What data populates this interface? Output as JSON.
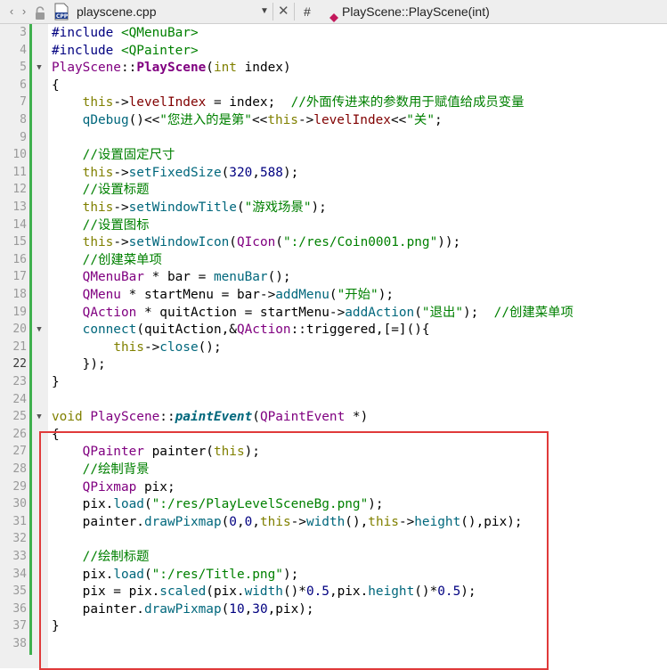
{
  "tabbar": {
    "back_glyph": "‹",
    "forward_glyph": "›",
    "lock_icon": "lock-icon",
    "file_icon": "cpp-file-icon",
    "filename": "playscene.cpp",
    "dropdown_glyph": "▼",
    "close_glyph": "✕",
    "symbol_hash": "#",
    "function_icon": "function-icon",
    "current_function": "PlayScene::PlayScene(int)"
  },
  "colors": {
    "highlight_box": "#e03a3a",
    "modified_bar": "#3fb04e",
    "function_icon": "#c2185b"
  },
  "lines": [
    {
      "num": "3",
      "fold": "",
      "cur": false,
      "tokens": [
        [
          "pp",
          "#include "
        ],
        [
          "inc",
          "<QMenuBar>"
        ]
      ]
    },
    {
      "num": "4",
      "fold": "",
      "cur": false,
      "tokens": [
        [
          "pp",
          "#include "
        ],
        [
          "inc",
          "<QPainter>"
        ]
      ]
    },
    {
      "num": "5",
      "fold": "▼",
      "cur": false,
      "tokens": [
        [
          "cls",
          "PlayScene"
        ],
        [
          "",
          "::"
        ],
        [
          "cls bold",
          "PlayScene"
        ],
        [
          "",
          "("
        ],
        [
          "kw",
          "int"
        ],
        [
          "",
          " index)"
        ]
      ]
    },
    {
      "num": "6",
      "fold": "",
      "cur": false,
      "tokens": [
        [
          "",
          "{"
        ]
      ]
    },
    {
      "num": "7",
      "fold": "",
      "cur": false,
      "tokens": [
        [
          "",
          "    "
        ],
        [
          "kw",
          "this"
        ],
        [
          "",
          "->"
        ],
        [
          "mem",
          "levelIndex"
        ],
        [
          "",
          " = index;  "
        ],
        [
          "cmt",
          "//外面传进来的参数用于赋值给成员变量"
        ]
      ]
    },
    {
      "num": "8",
      "fold": "",
      "cur": false,
      "tokens": [
        [
          "",
          "    "
        ],
        [
          "fn",
          "qDebug"
        ],
        [
          "",
          "()<<"
        ],
        [
          "str",
          "\"您进入的是第\""
        ],
        [
          "",
          "<<"
        ],
        [
          "kw",
          "this"
        ],
        [
          "",
          "->"
        ],
        [
          "mem",
          "levelIndex"
        ],
        [
          "",
          "<<"
        ],
        [
          "str",
          "\"关\""
        ],
        [
          "",
          ";"
        ]
      ]
    },
    {
      "num": "9",
      "fold": "",
      "cur": false,
      "tokens": []
    },
    {
      "num": "10",
      "fold": "",
      "cur": false,
      "tokens": [
        [
          "",
          "    "
        ],
        [
          "cmt",
          "//设置固定尺寸"
        ]
      ]
    },
    {
      "num": "11",
      "fold": "",
      "cur": false,
      "tokens": [
        [
          "",
          "    "
        ],
        [
          "kw",
          "this"
        ],
        [
          "",
          "->"
        ],
        [
          "fn",
          "setFixedSize"
        ],
        [
          "",
          "("
        ],
        [
          "num",
          "320"
        ],
        [
          "",
          ","
        ],
        [
          "num",
          "588"
        ],
        [
          "",
          ");"
        ]
      ]
    },
    {
      "num": "12",
      "fold": "",
      "cur": false,
      "tokens": [
        [
          "",
          "    "
        ],
        [
          "cmt",
          "//设置标题"
        ]
      ]
    },
    {
      "num": "13",
      "fold": "",
      "cur": false,
      "tokens": [
        [
          "",
          "    "
        ],
        [
          "kw",
          "this"
        ],
        [
          "",
          "->"
        ],
        [
          "fn",
          "setWindowTitle"
        ],
        [
          "",
          "("
        ],
        [
          "str",
          "\"游戏场景\""
        ],
        [
          "",
          ");"
        ]
      ]
    },
    {
      "num": "14",
      "fold": "",
      "cur": false,
      "tokens": [
        [
          "",
          "    "
        ],
        [
          "cmt",
          "//设置图标"
        ]
      ]
    },
    {
      "num": "15",
      "fold": "",
      "cur": false,
      "tokens": [
        [
          "",
          "    "
        ],
        [
          "kw",
          "this"
        ],
        [
          "",
          "->"
        ],
        [
          "fn",
          "setWindowIcon"
        ],
        [
          "",
          "("
        ],
        [
          "cls",
          "QIcon"
        ],
        [
          "",
          "("
        ],
        [
          "str",
          "\":/res/Coin0001.png\""
        ],
        [
          "",
          "));"
        ]
      ]
    },
    {
      "num": "16",
      "fold": "",
      "cur": false,
      "tokens": [
        [
          "",
          "    "
        ],
        [
          "cmt",
          "//创建菜单项"
        ]
      ]
    },
    {
      "num": "17",
      "fold": "",
      "cur": false,
      "tokens": [
        [
          "",
          "    "
        ],
        [
          "cls",
          "QMenuBar"
        ],
        [
          "",
          " * bar = "
        ],
        [
          "fn",
          "menuBar"
        ],
        [
          "",
          "();"
        ]
      ]
    },
    {
      "num": "18",
      "fold": "",
      "cur": false,
      "tokens": [
        [
          "",
          "    "
        ],
        [
          "cls",
          "QMenu"
        ],
        [
          "",
          " * startMenu = bar->"
        ],
        [
          "fn",
          "addMenu"
        ],
        [
          "",
          "("
        ],
        [
          "str",
          "\"开始\""
        ],
        [
          "",
          ");"
        ]
      ]
    },
    {
      "num": "19",
      "fold": "",
      "cur": false,
      "tokens": [
        [
          "",
          "    "
        ],
        [
          "cls",
          "QAction"
        ],
        [
          "",
          " * quitAction = startMenu->"
        ],
        [
          "fn",
          "addAction"
        ],
        [
          "",
          "("
        ],
        [
          "str",
          "\"退出\""
        ],
        [
          "",
          ");  "
        ],
        [
          "cmt",
          "//创建菜单项"
        ]
      ]
    },
    {
      "num": "20",
      "fold": "▼",
      "cur": false,
      "tokens": [
        [
          "",
          "    "
        ],
        [
          "fn",
          "connect"
        ],
        [
          "",
          "(quitAction,&"
        ],
        [
          "cls",
          "QAction"
        ],
        [
          "",
          "::triggered,[=](){"
        ]
      ]
    },
    {
      "num": "21",
      "fold": "",
      "cur": false,
      "tokens": [
        [
          "",
          "        "
        ],
        [
          "kw",
          "this"
        ],
        [
          "",
          "->"
        ],
        [
          "fn",
          "close"
        ],
        [
          "",
          "();"
        ]
      ]
    },
    {
      "num": "22",
      "fold": "",
      "cur": true,
      "tokens": [
        [
          "",
          "    });"
        ]
      ]
    },
    {
      "num": "23",
      "fold": "",
      "cur": false,
      "tokens": [
        [
          "",
          "}"
        ]
      ]
    },
    {
      "num": "24",
      "fold": "",
      "cur": false,
      "tokens": []
    },
    {
      "num": "25",
      "fold": "▼",
      "cur": false,
      "tokens": [
        [
          "kw",
          "void"
        ],
        [
          "",
          "",
          " "
        ],
        [
          "cls",
          " PlayScene"
        ],
        [
          "",
          "::"
        ],
        [
          "fn ital",
          "paintEvent"
        ],
        [
          "",
          "("
        ],
        [
          "cls",
          "QPaintEvent"
        ],
        [
          "",
          " *)"
        ]
      ]
    },
    {
      "num": "26",
      "fold": "",
      "cur": false,
      "tokens": [
        [
          "",
          "{"
        ]
      ]
    },
    {
      "num": "27",
      "fold": "",
      "cur": false,
      "tokens": [
        [
          "",
          "    "
        ],
        [
          "cls",
          "QPainter"
        ],
        [
          "",
          " painter("
        ],
        [
          "kw",
          "this"
        ],
        [
          "",
          ");"
        ]
      ]
    },
    {
      "num": "28",
      "fold": "",
      "cur": false,
      "tokens": [
        [
          "",
          "    "
        ],
        [
          "cmt",
          "//绘制背景"
        ]
      ]
    },
    {
      "num": "29",
      "fold": "",
      "cur": false,
      "tokens": [
        [
          "",
          "    "
        ],
        [
          "cls",
          "QPixmap"
        ],
        [
          "",
          " pix;"
        ]
      ]
    },
    {
      "num": "30",
      "fold": "",
      "cur": false,
      "tokens": [
        [
          "",
          "    pix."
        ],
        [
          "fn",
          "load"
        ],
        [
          "",
          "("
        ],
        [
          "str",
          "\":/res/PlayLevelSceneBg.png\""
        ],
        [
          "",
          ");"
        ]
      ]
    },
    {
      "num": "31",
      "fold": "",
      "cur": false,
      "tokens": [
        [
          "",
          "    painter."
        ],
        [
          "fn",
          "drawPixmap"
        ],
        [
          "",
          "("
        ],
        [
          "num",
          "0"
        ],
        [
          "",
          ","
        ],
        [
          "num",
          "0"
        ],
        [
          "",
          ","
        ],
        [
          "kw",
          "this"
        ],
        [
          "",
          "->"
        ],
        [
          "fn",
          "width"
        ],
        [
          "",
          "(),"
        ],
        [
          "kw",
          "this"
        ],
        [
          "",
          "->"
        ],
        [
          "fn",
          "height"
        ],
        [
          "",
          "(),pix);"
        ]
      ]
    },
    {
      "num": "32",
      "fold": "",
      "cur": false,
      "tokens": []
    },
    {
      "num": "33",
      "fold": "",
      "cur": false,
      "tokens": [
        [
          "",
          "    "
        ],
        [
          "cmt",
          "//绘制标题"
        ]
      ]
    },
    {
      "num": "34",
      "fold": "",
      "cur": false,
      "tokens": [
        [
          "",
          "    pix."
        ],
        [
          "fn",
          "load"
        ],
        [
          "",
          "("
        ],
        [
          "str",
          "\":/res/Title.png\""
        ],
        [
          "",
          ");"
        ]
      ]
    },
    {
      "num": "35",
      "fold": "",
      "cur": false,
      "tokens": [
        [
          "",
          "    pix = pix."
        ],
        [
          "fn",
          "scaled"
        ],
        [
          "",
          "(pix."
        ],
        [
          "fn",
          "width"
        ],
        [
          "",
          "()*"
        ],
        [
          "num",
          "0.5"
        ],
        [
          "",
          ",pix."
        ],
        [
          "fn",
          "height"
        ],
        [
          "",
          "()*"
        ],
        [
          "num",
          "0.5"
        ],
        [
          "",
          ");"
        ]
      ]
    },
    {
      "num": "36",
      "fold": "",
      "cur": false,
      "tokens": [
        [
          "",
          "    painter."
        ],
        [
          "fn",
          "drawPixmap"
        ],
        [
          "",
          "("
        ],
        [
          "num",
          "10"
        ],
        [
          "",
          ","
        ],
        [
          "num",
          "30"
        ],
        [
          "",
          ",pix);"
        ]
      ]
    },
    {
      "num": "37",
      "fold": "",
      "cur": false,
      "tokens": [
        [
          "",
          "}"
        ]
      ]
    },
    {
      "num": "38",
      "fold": "",
      "cur": false,
      "tokens": []
    }
  ]
}
